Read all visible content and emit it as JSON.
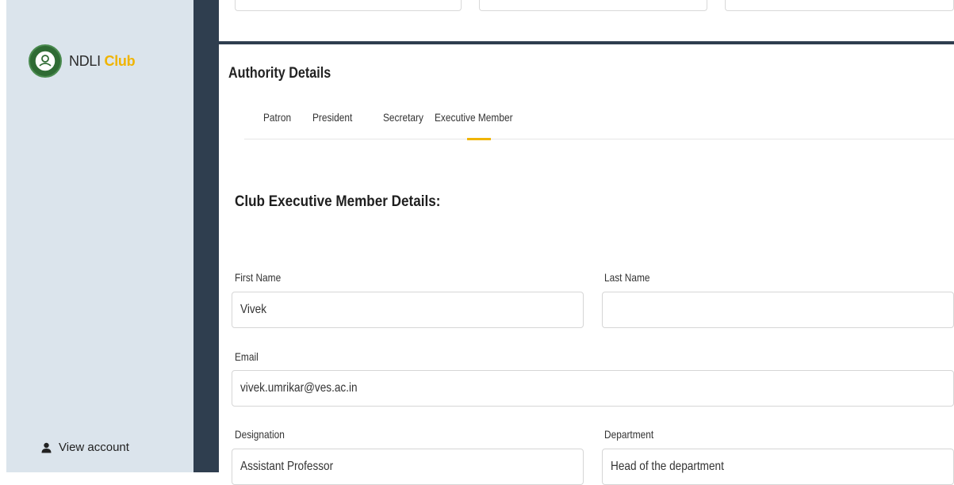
{
  "sidebar": {
    "logo_text": "NDLI",
    "logo_accent": "Club",
    "view_account": "View account"
  },
  "authority": {
    "title": "Authority Details",
    "tabs": [
      "Patron",
      "President",
      "Secretary",
      "Executive Member"
    ],
    "active_tab": "Executive Member"
  },
  "form": {
    "heading": "Club Executive Member Details:",
    "first_name": {
      "label": "First Name",
      "value": "Vivek"
    },
    "last_name": {
      "label": "Last Name",
      "value": ""
    },
    "email": {
      "label": "Email",
      "value": "vivek.umrikar@ves.ac.in"
    },
    "designation": {
      "label": "Designation",
      "value": "Assistant Professor"
    },
    "department": {
      "label": "Department",
      "value": "Head of the department"
    }
  },
  "colors": {
    "sidebar_bg": "#dbe4ec",
    "dark_bar": "#2f3e4f",
    "accent": "#f0b400"
  }
}
